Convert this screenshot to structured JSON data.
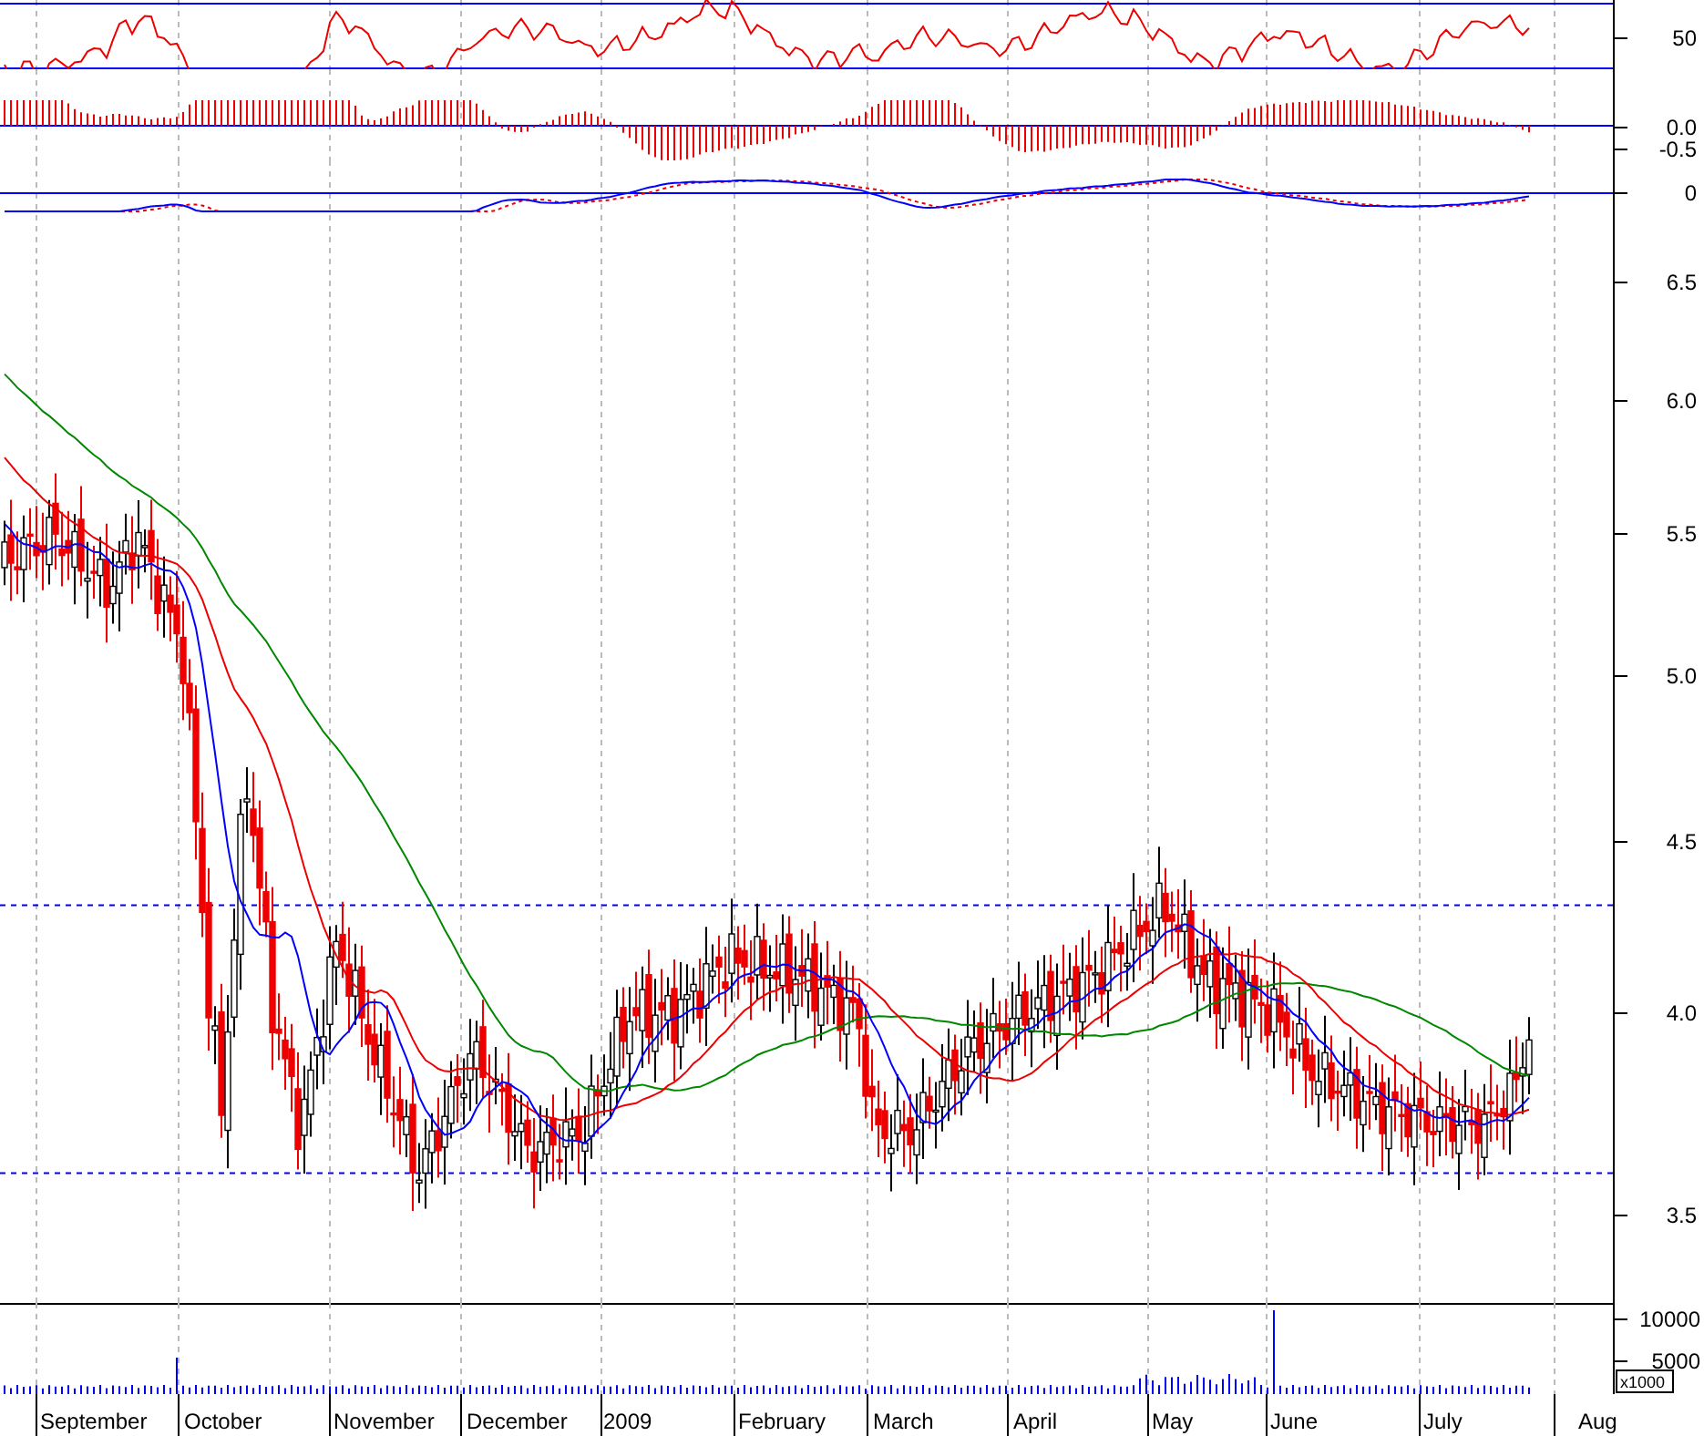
{
  "indicators": {
    "rsi": {
      "ticks": [
        "50"
      ]
    },
    "macd": {
      "ticks": [
        "0.0",
        "-0.5"
      ]
    },
    "oscillator": {
      "ticks": [
        "0"
      ]
    }
  },
  "price": {
    "ticks": [
      "6.5",
      "6.0",
      "5.5",
      "5.0",
      "4.5",
      "4.0",
      "3.5"
    ]
  },
  "volume": {
    "ticks": [
      "10000",
      "5000"
    ],
    "unit": "x1000"
  },
  "months": [
    "September",
    "October",
    "November",
    "December",
    "2009",
    "February",
    "March",
    "April",
    "May",
    "June",
    "July",
    "Aug"
  ]
}
